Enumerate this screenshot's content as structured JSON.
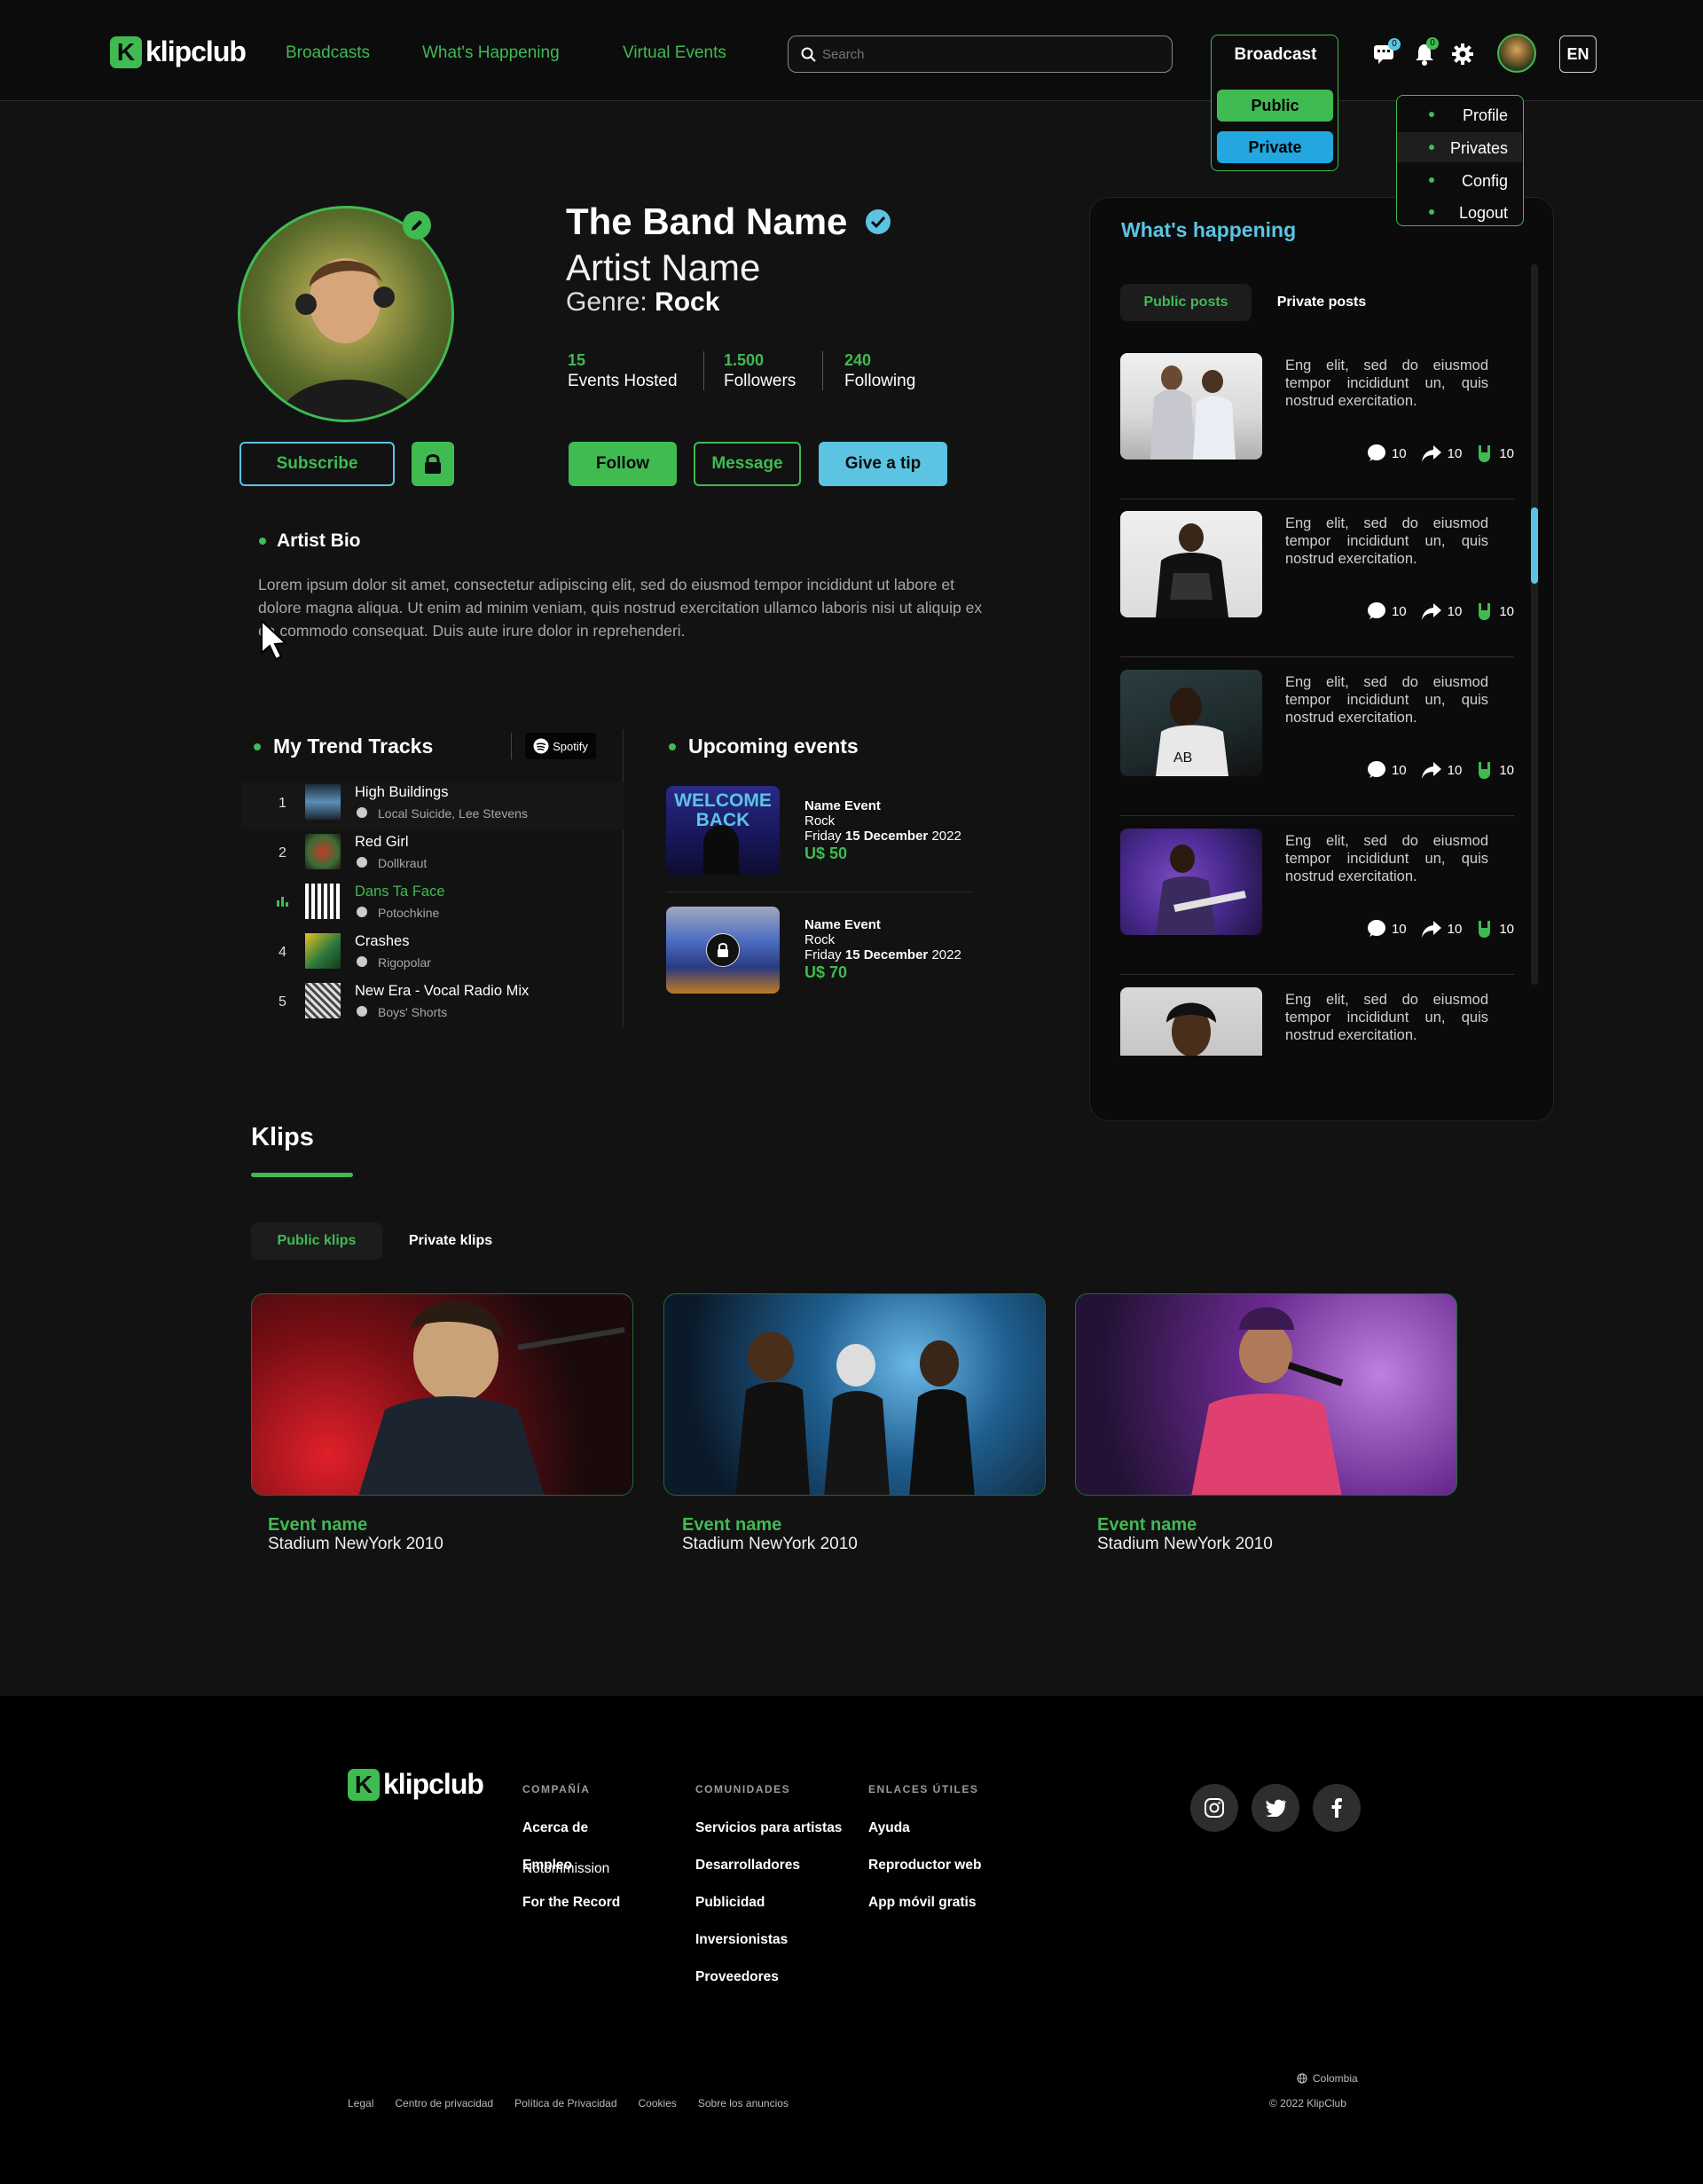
{
  "header": {
    "logo_letter": "K",
    "logo_text": "klipclub",
    "nav": [
      "Broadcasts",
      "What's Happening",
      "Virtual Events"
    ],
    "search_placeholder": "Search",
    "broadcast": {
      "title": "Broadcast",
      "public": "Public",
      "private": "Private"
    },
    "messages_badge": "0",
    "notifications_badge": "0",
    "language": "EN",
    "user_menu": [
      "Profile",
      "Privates",
      "Config",
      "Logout"
    ]
  },
  "profile": {
    "band_name": "The Band Name",
    "artist_name": "Artist Name",
    "genre_label": "Genre:",
    "genre_value": "Rock",
    "stats": [
      {
        "value": "15",
        "label": "Events Hosted"
      },
      {
        "value": "1.500",
        "label": "Followers"
      },
      {
        "value": "240",
        "label": "Following"
      }
    ],
    "subscribe": "Subscribe",
    "follow": "Follow",
    "message": "Message",
    "tip": "Give a tip"
  },
  "bio": {
    "title": "Artist Bio",
    "text": "Lorem ipsum dolor sit amet, consectetur adipiscing elit, sed do eiusmod tempor incididunt ut labore et dolore magna aliqua. Ut enim ad minim veniam, quis nostrud exercitation ullamco laboris nisi ut aliquip ex ea commodo consequat. Duis aute irure dolor in reprehenderi."
  },
  "tracks": {
    "title": "My Trend Tracks",
    "spotify": "Spotify",
    "items": [
      {
        "num": "1",
        "name": "High Buildings",
        "artist": "Local Suicide, Lee Stevens",
        "playing": false
      },
      {
        "num": "2",
        "name": "Red Girl",
        "artist": "Dollkraut",
        "playing": false
      },
      {
        "num": "",
        "name": "Dans Ta Face",
        "artist": "Potochkine",
        "playing": true
      },
      {
        "num": "4",
        "name": "Crashes",
        "artist": "Rigopolar",
        "playing": false
      },
      {
        "num": "5",
        "name": "New Era - Vocal Radio Mix",
        "artist": "Boys' Shorts",
        "playing": false
      }
    ]
  },
  "events": {
    "title": "Upcoming events",
    "poster_text": "WELCOME BACK",
    "items": [
      {
        "name": "Name Event",
        "genre": "Rock",
        "day": "Friday",
        "date_bold": "15 December",
        "year": "2022",
        "price": "U$ 50",
        "locked": false
      },
      {
        "name": "Name Event",
        "genre": "Rock",
        "day": "Friday",
        "date_bold": "15 December",
        "year": "2022",
        "price": "U$ 70",
        "locked": true
      }
    ]
  },
  "happening": {
    "title": "What's happening",
    "tabs": [
      "Public posts",
      "Private posts"
    ],
    "post_text": "Eng elit, sed do eiusmod tempor incididunt un, quis nostrud exercitation.",
    "counts": {
      "comments": "10",
      "shares": "10",
      "rocks": "10"
    }
  },
  "klips": {
    "title": "Klips",
    "tabs": [
      "Public klips",
      "Private klips"
    ],
    "items": [
      {
        "name": "Event name",
        "place": "Stadium NewYork 2010"
      },
      {
        "name": "Event name",
        "place": "Stadium NewYork 2010"
      },
      {
        "name": "Event name",
        "place": "Stadium NewYork 2010"
      }
    ]
  },
  "footer": {
    "logo_text": "klipclub",
    "columns": [
      {
        "title": "COMPAÑÍA",
        "links": [
          "Acerca de",
          "Empleo",
          "For the Record"
        ],
        "overlap": "Notommission"
      },
      {
        "title": "COMUNIDADES",
        "links": [
          "Servicios para artistas",
          "Desarrolladores",
          "Publicidad",
          "Inversionistas",
          "Proveedores"
        ]
      },
      {
        "title": "ENLACES ÚTILES",
        "links": [
          "Ayuda",
          "Reproductor web",
          "App móvil gratis"
        ]
      }
    ],
    "legal": [
      "Legal",
      "Centro de privacidad",
      "Política de Privacidad",
      "Cookies",
      "Sobre los anuncios"
    ],
    "country": "Colombia",
    "copyright": "© 2022 KlipClub"
  },
  "colors": {
    "accent": "#3fbb52",
    "blue": "#5bc4e3",
    "private_btn": "#23a7e0",
    "bg": "#121212"
  }
}
